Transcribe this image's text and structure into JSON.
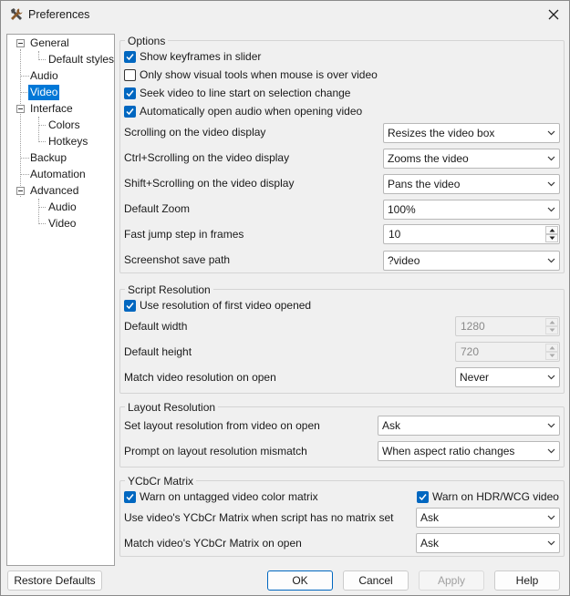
{
  "window": {
    "title": "Preferences"
  },
  "icons": {
    "app": "hammer-wrench-icon",
    "close": "close-icon",
    "checkmark": "checkmark-icon",
    "chevron": "chevron-down-icon"
  },
  "colors": {
    "accent": "#0067c0",
    "selection": "#0078d7"
  },
  "tree": {
    "general": "General",
    "default_styles": "Default styles",
    "audio": "Audio",
    "video": "Video",
    "interface": "Interface",
    "colors": "Colors",
    "hotkeys": "Hotkeys",
    "backup": "Backup",
    "automation": "Automation",
    "advanced": "Advanced",
    "adv_audio": "Audio",
    "adv_video": "Video",
    "selected": "Video"
  },
  "options": {
    "title": "Options",
    "show_keyframes": {
      "label": "Show keyframes in slider",
      "checked": true
    },
    "visual_tools": {
      "label": "Only show visual tools when mouse is over video",
      "checked": false
    },
    "seek_video": {
      "label": "Seek video to line start on selection change",
      "checked": true
    },
    "auto_audio": {
      "label": "Automatically open audio when opening video",
      "checked": true
    },
    "scrolling": {
      "label": "Scrolling on the video display",
      "value": "Resizes the video box"
    },
    "ctrl_scrolling": {
      "label": "Ctrl+Scrolling on the video display",
      "value": "Zooms the video"
    },
    "shift_scrolling": {
      "label": "Shift+Scrolling on the video display",
      "value": "Pans the video"
    },
    "default_zoom": {
      "label": "Default Zoom",
      "value": "100%"
    },
    "fast_jump": {
      "label": "Fast jump step in frames",
      "value": "10"
    },
    "screenshot_path": {
      "label": "Screenshot save path",
      "value": "?video"
    }
  },
  "script_resolution": {
    "title": "Script Resolution",
    "use_first": {
      "label": "Use resolution of first video opened",
      "checked": true
    },
    "default_width": {
      "label": "Default width",
      "value": "1280"
    },
    "default_height": {
      "label": "Default height",
      "value": "720"
    },
    "match_on_open": {
      "label": "Match video resolution on open",
      "value": "Never"
    }
  },
  "layout_resolution": {
    "title": "Layout Resolution",
    "set_from_video": {
      "label": "Set layout resolution from video on open",
      "value": "Ask"
    },
    "prompt_mismatch": {
      "label": "Prompt on layout resolution mismatch",
      "value": "When aspect ratio changes"
    }
  },
  "ycbcr": {
    "title": "YCbCr Matrix",
    "warn_untagged": {
      "label": "Warn on untagged video color matrix",
      "checked": true
    },
    "warn_hdr": {
      "label": "Warn on HDR/WCG video",
      "checked": true
    },
    "use_video_matrix": {
      "label": "Use video's YCbCr Matrix when script has no matrix set",
      "value": "Ask"
    },
    "match_matrix": {
      "label": "Match video's YCbCr Matrix on open",
      "value": "Ask"
    }
  },
  "buttons": {
    "restore": "Restore Defaults",
    "ok": "OK",
    "cancel": "Cancel",
    "apply": "Apply",
    "help": "Help"
  }
}
